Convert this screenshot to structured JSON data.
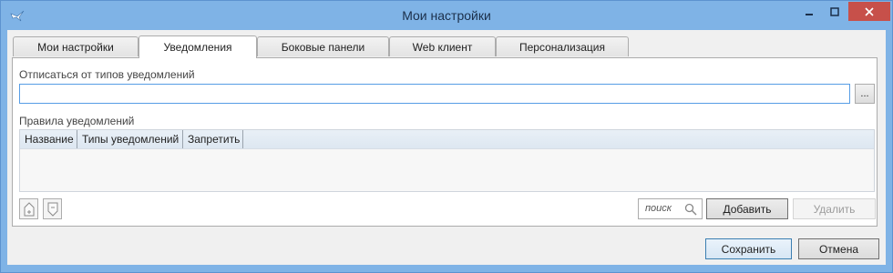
{
  "window": {
    "title": "Мои настройки",
    "icon": "app-bird-icon",
    "controls": [
      "minimize-icon",
      "maximize-icon",
      "close-icon"
    ]
  },
  "tabs": [
    {
      "label": "Мои настройки",
      "active": false
    },
    {
      "label": "Уведомления",
      "active": true
    },
    {
      "label": "Боковые панели",
      "active": false
    },
    {
      "label": "Web клиент",
      "active": false
    },
    {
      "label": "Персонализация",
      "active": false
    }
  ],
  "unsubscribe": {
    "label": "Отписаться от типов уведомлений",
    "value": "",
    "browse_label": "..."
  },
  "rules": {
    "label": "Правила уведомлений",
    "columns": [
      "Название",
      "Типы уведомлений",
      "Запретить"
    ],
    "rows": []
  },
  "toolbar": {
    "search_placeholder": "поиск",
    "add_label": "Добавить",
    "delete_label": "Удалить"
  },
  "footer": {
    "save_label": "Сохранить",
    "cancel_label": "Отмена"
  },
  "colors": {
    "window_frame": "#7fb3e6",
    "close_button": "#c7504a",
    "input_focus": "#569de5"
  }
}
